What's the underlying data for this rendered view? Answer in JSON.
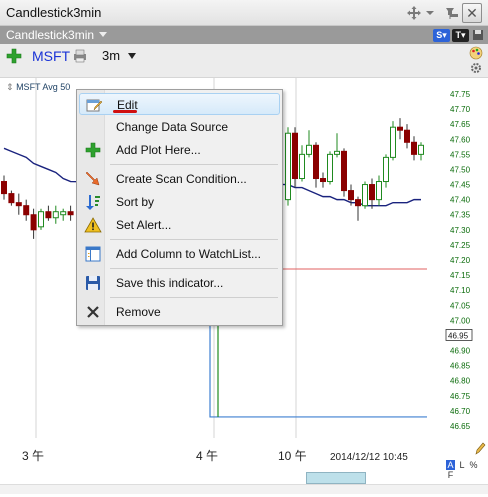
{
  "window": {
    "title": "Candlestick3min"
  },
  "grid": {
    "name": "Candlestick3min"
  },
  "toolbar": {
    "symbol": "MSFT",
    "interval": "3m"
  },
  "badges": {
    "s_label": "S",
    "t_label": "T"
  },
  "study": {
    "label": "MSFT  Avg 50"
  },
  "context_menu": {
    "items": [
      {
        "label": "Edit",
        "icon": "edit-icon"
      },
      {
        "label": "Change Data Source",
        "icon": ""
      },
      {
        "label": "Add Plot Here...",
        "icon": "add-plot-icon"
      },
      {
        "label": "Create Scan Condition...",
        "icon": "scan-icon"
      },
      {
        "label": "Sort by",
        "icon": "sort-icon"
      },
      {
        "label": "Set Alert...",
        "icon": "alert-icon"
      },
      {
        "label": "Add Column to WatchList...",
        "icon": "watchlist-icon"
      },
      {
        "label": "Save this indicator...",
        "icon": "save-icon"
      },
      {
        "label": "Remove",
        "icon": "remove-icon"
      }
    ]
  },
  "axis": {
    "price_ticks": [
      "47.75",
      "47.70",
      "47.65",
      "47.60",
      "47.55",
      "47.50",
      "47.45",
      "47.40",
      "47.35",
      "47.30",
      "47.25",
      "47.20",
      "47.15",
      "47.10",
      "47.05",
      "47.00",
      "46.95",
      "46.90",
      "46.85",
      "46.80",
      "46.75",
      "46.70",
      "46.65"
    ],
    "boxed_tick": "46.95",
    "time_labels": [
      "3 午",
      "4 午",
      "10 午"
    ],
    "timestamp": "2014/12/12 10:45",
    "scale_buttons": [
      "A",
      "L",
      "%",
      "F"
    ]
  },
  "colors": {
    "up": "#1f8a1f",
    "down": "#8b0000",
    "ma": "#1a237e",
    "hline_red": "#e06060",
    "hline_blue": "#3d7fd1",
    "axis_text": "#0a6b0a",
    "accent": "#1a33d6"
  },
  "chart_data": {
    "type": "candlestick",
    "title": "",
    "ylim": [
      46.65,
      47.75
    ],
    "candles": [
      {
        "o": 47.46,
        "h": 47.48,
        "l": 47.4,
        "c": 47.42
      },
      {
        "o": 47.42,
        "h": 47.43,
        "l": 47.38,
        "c": 47.39
      },
      {
        "o": 47.39,
        "h": 47.42,
        "l": 47.35,
        "c": 47.38
      },
      {
        "o": 47.38,
        "h": 47.4,
        "l": 47.33,
        "c": 47.35
      },
      {
        "o": 47.35,
        "h": 47.37,
        "l": 47.27,
        "c": 47.3
      },
      {
        "o": 47.31,
        "h": 47.37,
        "l": 47.3,
        "c": 47.36
      },
      {
        "o": 47.36,
        "h": 47.38,
        "l": 47.33,
        "c": 47.34
      },
      {
        "o": 47.34,
        "h": 47.38,
        "l": 47.32,
        "c": 47.36
      },
      {
        "o": 47.35,
        "h": 47.37,
        "l": 47.33,
        "c": 47.36
      },
      {
        "o": 47.36,
        "h": 47.38,
        "l": 47.33,
        "c": 47.35
      },
      {
        "o": 47.4,
        "h": 47.64,
        "l": 47.38,
        "c": 47.62
      },
      {
        "o": 47.62,
        "h": 47.64,
        "l": 47.44,
        "c": 47.47
      },
      {
        "o": 47.47,
        "h": 47.58,
        "l": 47.46,
        "c": 47.55
      },
      {
        "o": 47.55,
        "h": 47.63,
        "l": 47.54,
        "c": 47.58
      },
      {
        "o": 47.58,
        "h": 47.59,
        "l": 47.44,
        "c": 47.47
      },
      {
        "o": 47.47,
        "h": 47.49,
        "l": 47.44,
        "c": 47.46
      },
      {
        "o": 47.46,
        "h": 47.56,
        "l": 47.45,
        "c": 47.55
      },
      {
        "o": 47.55,
        "h": 47.62,
        "l": 47.54,
        "c": 47.56
      },
      {
        "o": 47.56,
        "h": 47.57,
        "l": 47.41,
        "c": 47.43
      },
      {
        "o": 47.43,
        "h": 47.45,
        "l": 47.38,
        "c": 47.4
      },
      {
        "o": 47.4,
        "h": 47.41,
        "l": 47.33,
        "c": 47.38
      },
      {
        "o": 47.38,
        "h": 47.46,
        "l": 47.37,
        "c": 47.45
      },
      {
        "o": 47.45,
        "h": 47.47,
        "l": 47.37,
        "c": 47.4
      },
      {
        "o": 47.4,
        "h": 47.48,
        "l": 47.38,
        "c": 47.46
      },
      {
        "o": 47.46,
        "h": 47.55,
        "l": 47.44,
        "c": 47.54
      },
      {
        "o": 47.54,
        "h": 47.66,
        "l": 47.53,
        "c": 47.64
      },
      {
        "o": 47.64,
        "h": 47.67,
        "l": 47.6,
        "c": 47.63
      },
      {
        "o": 47.63,
        "h": 47.65,
        "l": 47.57,
        "c": 47.59
      },
      {
        "o": 47.59,
        "h": 47.61,
        "l": 47.53,
        "c": 47.55
      },
      {
        "o": 47.55,
        "h": 47.59,
        "l": 47.53,
        "c": 47.58
      }
    ],
    "ma_label": "Avg 50",
    "ma": [
      47.57,
      47.56,
      47.55,
      47.54,
      47.52,
      47.51,
      47.5,
      47.49,
      47.47,
      47.46,
      47.45,
      47.44,
      47.44,
      47.43,
      47.42,
      47.41,
      47.41,
      47.4,
      47.4,
      47.39,
      47.39,
      47.38,
      47.38,
      47.38,
      47.38,
      47.39,
      47.39,
      47.39,
      47.4,
      47.4
    ],
    "h_red": 47.17,
    "h_blue": 46.68
  }
}
